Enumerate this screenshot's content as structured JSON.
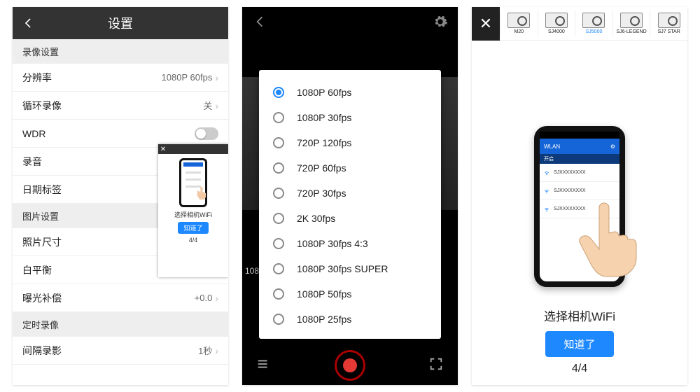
{
  "panel1": {
    "title": "设置",
    "sections": {
      "video_head": "录像设置",
      "photo_head": "图片设置",
      "timer_head": "定时录像"
    },
    "rows": {
      "resolution": {
        "label": "分辨率",
        "value": "1080P 60fps"
      },
      "loop": {
        "label": "循环录像",
        "value": "关"
      },
      "wdr": {
        "label": "WDR"
      },
      "audio": {
        "label": "录音"
      },
      "datestamp": {
        "label": "日期标签"
      },
      "photosize": {
        "label": "照片尺寸"
      },
      "wb": {
        "label": "白平衡"
      },
      "ev": {
        "label": "曝光补偿",
        "value": "+0.0"
      },
      "interval": {
        "label": "间隔录影",
        "value": "1秒"
      }
    },
    "mini": {
      "caption": "选择相机WiFi",
      "btn": "知道了",
      "pager": "4/4"
    }
  },
  "panel2": {
    "options": [
      "1080P 60fps",
      "1080P 30fps",
      "720P 120fps",
      "720P 60fps",
      "720P 30fps",
      "2K 30fps",
      "1080P 30fps 4:3",
      "1080P 30fps SUPER",
      "1080P 50fps",
      "1080P 25fps"
    ],
    "selected_index": 0,
    "left_txt": "108"
  },
  "panel3": {
    "cameras": [
      "M20",
      "SJ4000",
      "SJ5000",
      "SJ6-LEGEND",
      "SJ7 STAR"
    ],
    "selected_cam": 2,
    "phone": {
      "top": "WLAN",
      "gear": "⚙",
      "sub": "开启",
      "items": [
        "SJXXXXXXXX",
        "SJXXXXXXXX",
        "SJXXXXXXXX"
      ]
    },
    "caption": "选择相机WiFi",
    "ok": "知道了",
    "pager": "4/4"
  }
}
